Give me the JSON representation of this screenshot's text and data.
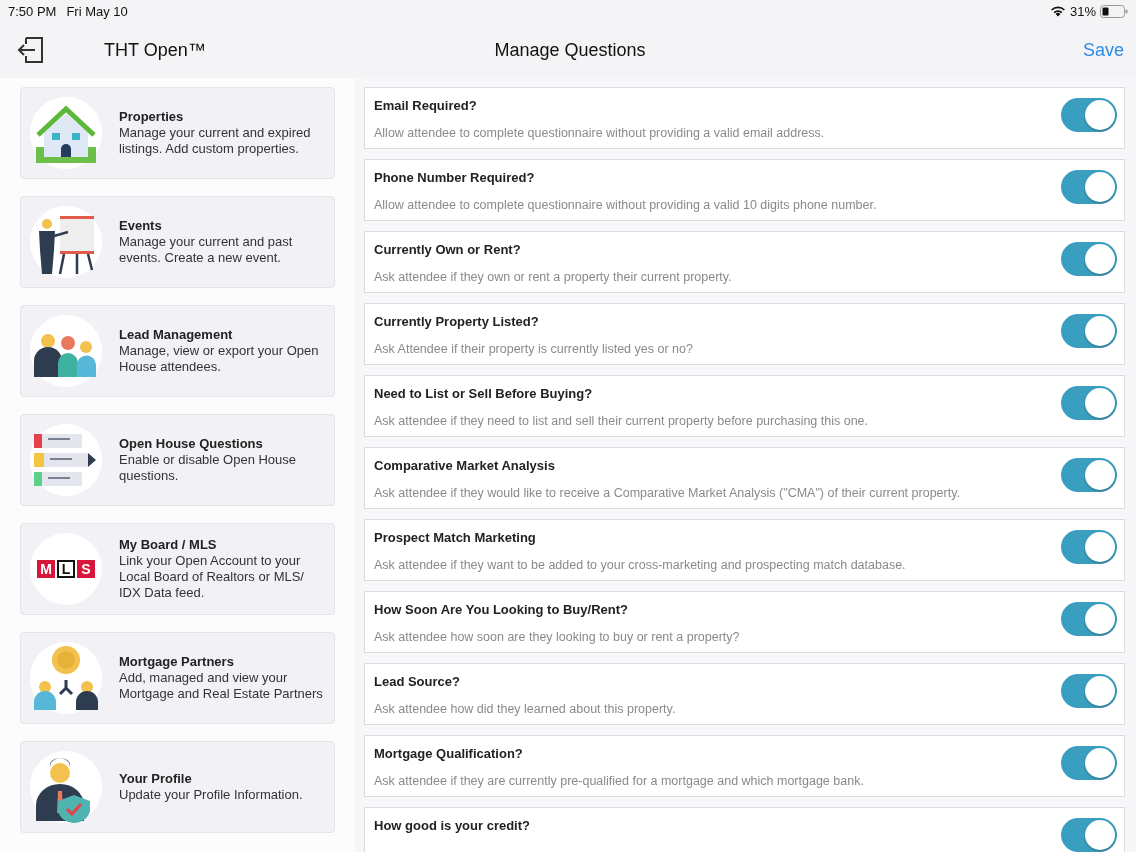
{
  "status_bar": {
    "time": "7:50 PM",
    "date": "Fri May 10",
    "battery": "31%"
  },
  "nav_bar": {
    "app_title": "THT Open™",
    "title": "Manage Questions",
    "save": "Save"
  },
  "sidebar": {
    "items": [
      {
        "kind": "house",
        "title": "Properties",
        "description": "Manage your current and expired listings.  Add custom properties."
      },
      {
        "kind": "presenter",
        "title": "Events",
        "description": "Manage your current and past events.  Create a new event."
      },
      {
        "kind": "people",
        "title": "Lead Management",
        "description": "Manage, view or export your Open House attendees."
      },
      {
        "kind": "questions",
        "title": "Open House Questions",
        "description": "Enable or disable Open House questions."
      },
      {
        "kind": "mls",
        "title": "My Board / MLS",
        "description": "Link your Open Account to your Local Board of Realtors or MLS/ IDX Data feed.",
        "logo_letters": [
          "M",
          "L",
          "S"
        ]
      },
      {
        "kind": "partners",
        "title": "Mortgage Partners",
        "description": "Add, managed and view your Mortgage and Real Estate Partners"
      },
      {
        "kind": "profile",
        "title": "Your Profile",
        "description": "Update your Profile Information."
      }
    ]
  },
  "questions": [
    {
      "title": "Email Required?",
      "description": "Allow attendee to complete questionnaire without providing a valid email address.",
      "on": true
    },
    {
      "title": "Phone Number Required?",
      "description": "Allow attendee to complete questionnaire without providing a valid  10 digits phone number.",
      "on": true
    },
    {
      "title": "Currently Own or Rent?",
      "description": "Ask attendee if they own or rent a property their current property.",
      "on": true
    },
    {
      "title": "Currently Property Listed?",
      "description": "Ask Attendee if their property is currently listed yes or no?",
      "on": true
    },
    {
      "title": "Need to List or Sell Before Buying?",
      "description": "Ask attendee if they need to list and sell their current property before purchasing this one.",
      "on": true
    },
    {
      "title": "Comparative Market Analysis",
      "description": "Ask attendee if they would like to receive a Comparative Market Analysis (\"CMA\") of their current property.",
      "on": true
    },
    {
      "title": "Prospect Match Marketing",
      "description": "Ask attendee if they want to be added to your cross-marketing and prospecting match database.",
      "on": true
    },
    {
      "title": "How Soon Are You Looking to Buy/Rent?",
      "description": "Ask attendee how soon are they looking to buy or rent a property?",
      "on": true
    },
    {
      "title": "Lead Source?",
      "description": "Ask attendee how did they learned about this property.",
      "on": true
    },
    {
      "title": "Mortgage Qualification?",
      "description": "Ask attendee if they are currently pre-qualified for a mortgage and which mortgage bank.",
      "on": true
    },
    {
      "title": "How good is your credit?",
      "on": true
    }
  ]
}
